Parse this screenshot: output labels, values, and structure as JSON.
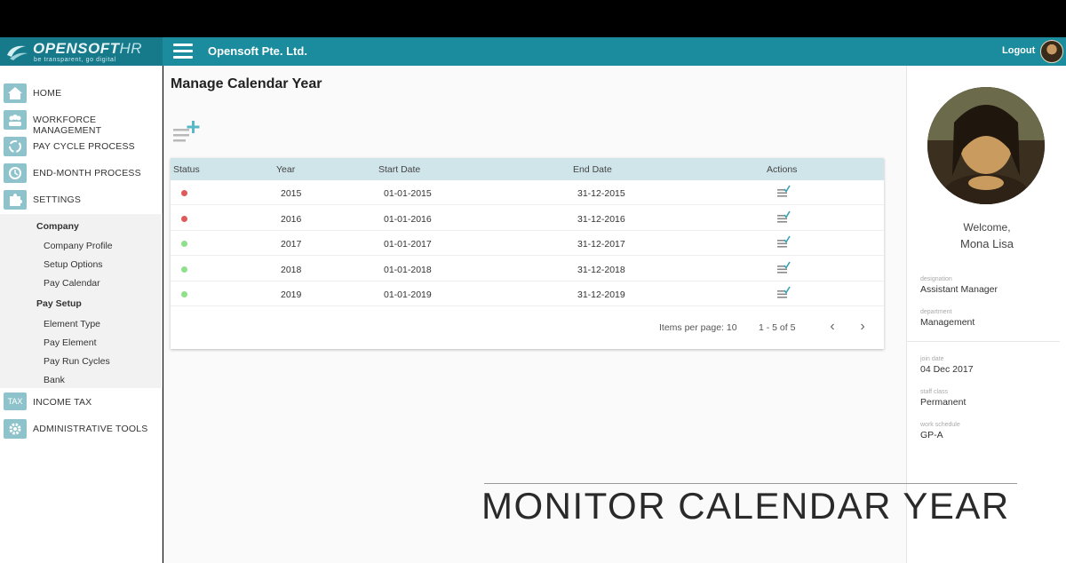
{
  "header": {
    "brand": "OPENSOFT",
    "brand_suffix": "HR",
    "tagline": "be transparent, go digital",
    "company": "Opensoft Pte. Ltd.",
    "logout": "Logout"
  },
  "sidebar": {
    "items": [
      {
        "label": "HOME",
        "icon": "home-icon"
      },
      {
        "label": "WORKFORCE MANAGEMENT",
        "icon": "people-icon"
      },
      {
        "label": "PAY CYCLE PROCESS",
        "icon": "cycle-icon"
      },
      {
        "label": "END-MONTH PROCESS",
        "icon": "calendar-icon"
      },
      {
        "label": "SETTINGS",
        "icon": "puzzle-icon"
      },
      {
        "label": "INCOME TAX",
        "icon": "tax-icon"
      },
      {
        "label": "ADMINISTRATIVE TOOLS",
        "icon": "gear-icon"
      }
    ],
    "tax_icon_text": "TAX",
    "settings_submenu": {
      "company_head": "Company",
      "company_items": [
        "Company Profile",
        "Setup Options",
        "Pay Calendar"
      ],
      "paysetup_head": "Pay Setup",
      "paysetup_items": [
        "Element Type",
        "Pay Element",
        "Pay Run Cycles",
        "Bank"
      ]
    }
  },
  "main": {
    "title": "Manage Calendar Year",
    "table": {
      "headers": [
        "Status",
        "Year",
        "Start Date",
        "End Date",
        "Actions"
      ],
      "rows": [
        {
          "status": "inactive",
          "year": "2015",
          "start": "01-01-2015",
          "end": "31-12-2015"
        },
        {
          "status": "inactive",
          "year": "2016",
          "start": "01-01-2016",
          "end": "31-12-2016"
        },
        {
          "status": "active",
          "year": "2017",
          "start": "01-01-2017",
          "end": "31-12-2017"
        },
        {
          "status": "active",
          "year": "2018",
          "start": "01-01-2018",
          "end": "31-12-2018"
        },
        {
          "status": "active",
          "year": "2019",
          "start": "01-01-2019",
          "end": "31-12-2019"
        }
      ]
    },
    "pager": {
      "items_per_page": "Items per page: 10",
      "range": "1 - 5 of 5"
    }
  },
  "profile": {
    "welcome": "Welcome,",
    "name": "Mona Lisa",
    "designation_label": "designation",
    "designation": "Assistant Manager",
    "department_label": "department",
    "department": "Management",
    "join_label": "join date",
    "join_date": "04 Dec 2017",
    "staff_label": "staff class",
    "staff_class": "Permanent",
    "schedule_label": "work schedule",
    "schedule": "GP-A"
  },
  "caption": "MONITOR CALENDAR YEAR",
  "colors": {
    "accent": "#1a8c9e",
    "status_inactive": "#e05a5a",
    "status_active": "#8fe08a",
    "table_header": "#cfe5ea"
  }
}
